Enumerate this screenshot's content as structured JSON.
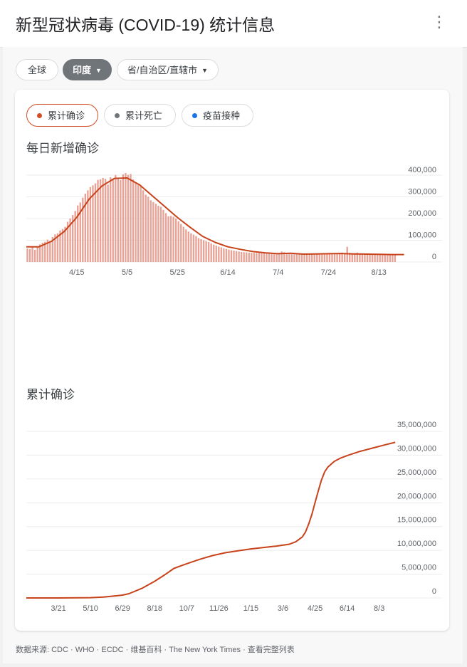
{
  "header": {
    "title": "新型冠状病毒 (COVID-19) 统计信息",
    "more": "⋮"
  },
  "filters": [
    {
      "label": "全球",
      "active": false,
      "dropdown": false
    },
    {
      "label": "印度",
      "active": true,
      "dropdown": true
    },
    {
      "label": "省/自治区/直辖市",
      "active": false,
      "dropdown": true
    }
  ],
  "metric_tabs": [
    {
      "label": "累计确诊",
      "color": "#d24d26",
      "active": true
    },
    {
      "label": "累计死亡",
      "color": "#70757a",
      "active": false
    },
    {
      "label": "疫苗接种",
      "color": "#1a73e8",
      "active": false
    }
  ],
  "colors": {
    "bar": "#e8a296",
    "line": "#c8431b",
    "grid": "#ececec"
  },
  "chart_data": [
    {
      "type": "bar",
      "title": "每日新增确诊",
      "xlabel": "",
      "ylabel": "",
      "ylim": [
        0,
        400000
      ],
      "y_ticks": [
        "400,000",
        "300,000",
        "200,000",
        "100,000",
        "0"
      ],
      "y_tick_values": [
        400000,
        300000,
        200000,
        100000,
        0
      ],
      "x_ticks": [
        "4/15",
        "5/5",
        "5/25",
        "6/14",
        "7/4",
        "7/24",
        "8/13"
      ],
      "x_tick_values": [
        20,
        40,
        60,
        80,
        100,
        120,
        140
      ],
      "x_tick_note": "x values are day offsets; day 0 = 3/26",
      "series": [
        {
          "name": "每日新增确诊",
          "values": [
            62000,
            60000,
            68000,
            56000,
            72000,
            81000,
            89000,
            93000,
            103000,
            96000,
            115000,
            127000,
            132000,
            145000,
            152000,
            162000,
            185000,
            200000,
            216000,
            235000,
            260000,
            274000,
            296000,
            315000,
            330000,
            345000,
            353000,
            362000,
            378000,
            381000,
            387000,
            383000,
            356000,
            390000,
            382000,
            401000,
            387000,
            377000,
            403000,
            410000,
            401000,
            405000,
            380000,
            365000,
            355000,
            348000,
            330000,
            310000,
            300000,
            284000,
            276000,
            268000,
            259000,
            254000,
            240000,
            225000,
            210000,
            212000,
            208000,
            200000,
            187000,
            175000,
            162000,
            150000,
            140000,
            132000,
            126000,
            119000,
            110000,
            105000,
            100000,
            96000,
            92000,
            85000,
            80000,
            75000,
            71000,
            67000,
            63000,
            60000,
            57000,
            54000,
            52000,
            50000,
            48000,
            46000,
            45000,
            44000,
            43000,
            42000,
            42000,
            41000,
            41000,
            40000,
            40000,
            39000,
            39000,
            38000,
            38000,
            40000,
            42000,
            48000,
            45000,
            41000,
            38000,
            37000,
            36000,
            37000,
            40000,
            38000,
            38000,
            37000,
            38000,
            38000,
            39000,
            39000,
            38000,
            38000,
            39000,
            40000,
            41000,
            40000,
            39000,
            41000,
            42000,
            43000,
            40000,
            70000,
            42000,
            40000,
            41000,
            43000,
            39000,
            37000,
            36000,
            35000,
            36000,
            38000,
            37000,
            36000,
            35000,
            34000,
            34000,
            35000,
            36000,
            34000,
            33000
          ],
          "smoothed": [
            [
              0,
              70000
            ],
            [
              5,
              70000
            ],
            [
              10,
              95000
            ],
            [
              15,
              140000
            ],
            [
              20,
              205000
            ],
            [
              25,
              290000
            ],
            [
              30,
              350000
            ],
            [
              35,
              385000
            ],
            [
              40,
              387000
            ],
            [
              45,
              355000
            ],
            [
              50,
              305000
            ],
            [
              55,
              255000
            ],
            [
              60,
              205000
            ],
            [
              65,
              160000
            ],
            [
              70,
              118000
            ],
            [
              75,
              90000
            ],
            [
              80,
              70000
            ],
            [
              85,
              58000
            ],
            [
              90,
              48000
            ],
            [
              95,
              42000
            ],
            [
              100,
              38000
            ],
            [
              105,
              40000
            ],
            [
              110,
              36000
            ],
            [
              115,
              37000
            ],
            [
              120,
              38000
            ],
            [
              125,
              39000
            ],
            [
              130,
              37000
            ],
            [
              135,
              36000
            ],
            [
              140,
              35000
            ],
            [
              145,
              34000
            ],
            [
              150,
              34000
            ]
          ]
        }
      ]
    },
    {
      "type": "line",
      "title": "累计确诊",
      "xlabel": "",
      "ylabel": "",
      "ylim": [
        0,
        35000000
      ],
      "y_ticks": [
        "35,000,000",
        "30,000,000",
        "25,000,000",
        "20,000,000",
        "15,000,000",
        "10,000,000",
        "5,000,000",
        "0"
      ],
      "y_tick_values": [
        35000000,
        30000000,
        25000000,
        20000000,
        15000000,
        10000000,
        5000000,
        0
      ],
      "x_ticks": [
        "3/21",
        "5/10",
        "6/29",
        "8/18",
        "10/7",
        "11/26",
        "1/15",
        "3/6",
        "4/25",
        "6/14",
        "8/3"
      ],
      "x_tick_values": [
        50,
        100,
        150,
        200,
        250,
        300,
        350,
        400,
        450,
        500,
        550
      ],
      "x_tick_note": "x values are day offsets; day 0 = 1/30",
      "series": [
        {
          "name": "累计确诊",
          "x": [
            0,
            50,
            100,
            120,
            140,
            150,
            160,
            180,
            200,
            215,
            230,
            250,
            270,
            290,
            310,
            330,
            350,
            370,
            390,
            410,
            420,
            430,
            435,
            440,
            445,
            450,
            455,
            460,
            465,
            470,
            480,
            490,
            500,
            520,
            540,
            560,
            575
          ],
          "values": [
            0,
            2000,
            60000,
            200000,
            450000,
            600000,
            900000,
            2000000,
            3500000,
            4800000,
            6200000,
            7200000,
            8100000,
            8900000,
            9500000,
            9900000,
            10300000,
            10600000,
            10900000,
            11300000,
            11800000,
            12800000,
            13800000,
            15500000,
            17500000,
            20000000,
            22500000,
            24800000,
            26500000,
            27500000,
            28700000,
            29400000,
            29900000,
            30800000,
            31500000,
            32200000,
            32700000
          ]
        }
      ]
    }
  ],
  "footer": {
    "sources": [
      "数据来源: CDC",
      "WHO",
      "ECDC",
      "维基百科",
      "The New York Times"
    ],
    "full_list_link": "查看完整列表",
    "separator": " · "
  }
}
